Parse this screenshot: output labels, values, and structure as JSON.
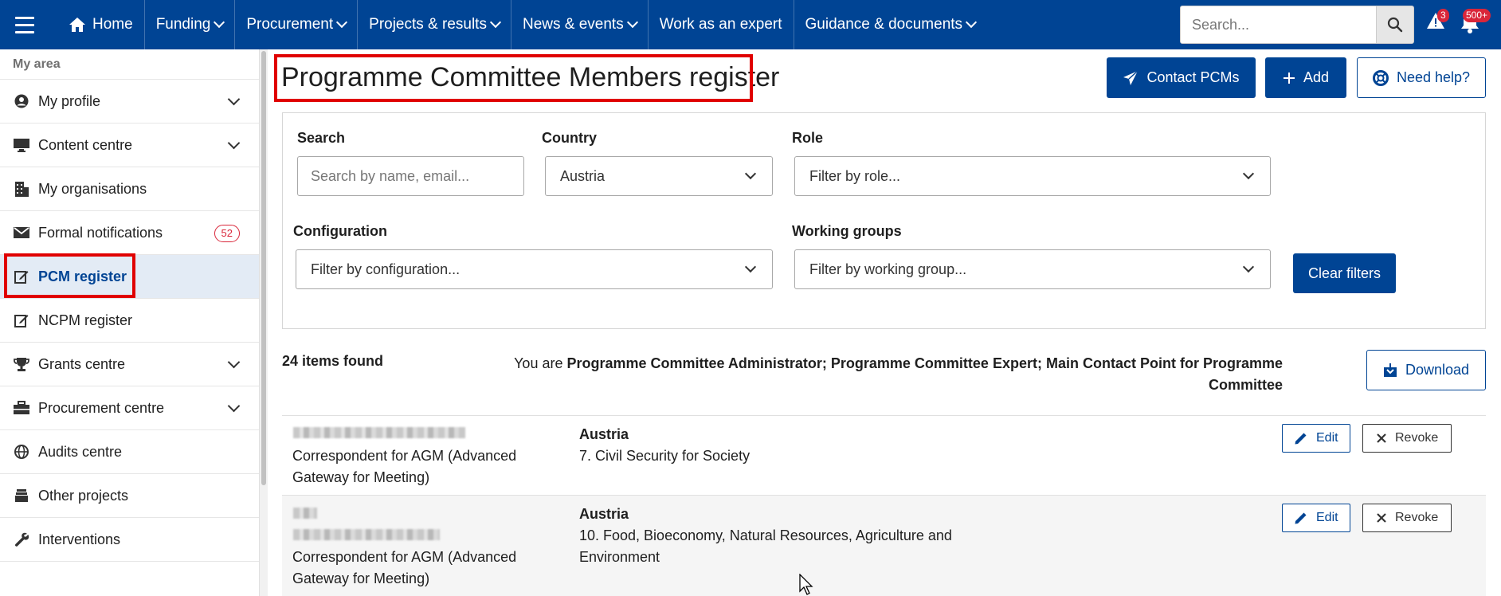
{
  "nav": {
    "home": "Home",
    "items": [
      "Funding",
      "Procurement",
      "Projects & results",
      "News & events",
      "Work as an expert",
      "Guidance & documents"
    ],
    "search_placeholder": "Search...",
    "alerts_count": "3",
    "notifications_count": "500+"
  },
  "sidebar": {
    "title": "My area",
    "items": [
      {
        "label": "My profile"
      },
      {
        "label": "Content centre"
      },
      {
        "label": "My organisations"
      },
      {
        "label": "Formal notifications",
        "badge": "52"
      },
      {
        "label": "PCM register"
      },
      {
        "label": "NCPM register"
      },
      {
        "label": "Grants centre"
      },
      {
        "label": "Procurement centre"
      },
      {
        "label": "Audits centre"
      },
      {
        "label": "Other projects"
      },
      {
        "label": "Interventions"
      }
    ]
  },
  "page": {
    "title": "Programme Committee Members register",
    "contact_label": "Contact PCMs",
    "add_label": "Add",
    "help_label": "Need help?"
  },
  "filters": {
    "search_label": "Search",
    "search_placeholder": "Search by name, email...",
    "country_label": "Country",
    "country_value": "Austria",
    "role_label": "Role",
    "role_placeholder": "Filter by role...",
    "configuration_label": "Configuration",
    "configuration_placeholder": "Filter by configuration...",
    "working_groups_label": "Working groups",
    "working_groups_placeholder": "Filter by working group...",
    "clear_label": "Clear filters"
  },
  "results": {
    "count": "24 items found",
    "you_are": "You are",
    "roles": "Programme Committee Administrator; Programme Committee Expert; Main Contact Point for Programme Committee",
    "download_label": "Download"
  },
  "rows": [
    {
      "role_line1": "Correspondent for AGM (Advanced",
      "role_line2": "Gateway for Meeting)",
      "country": "Austria",
      "config_line1": "7. Civil Security for Society",
      "config_line2": "",
      "edit": "Edit",
      "revoke": "Revoke"
    },
    {
      "role_line1": "Correspondent for AGM (Advanced",
      "role_line2": "Gateway for Meeting)",
      "country": "Austria",
      "config_line1": "10. Food, Bioeconomy, Natural Resources, Agriculture and",
      "config_line2": "Environment",
      "edit": "Edit",
      "revoke": "Revoke"
    }
  ],
  "colors": {
    "brand": "#004494",
    "highlight": "#e00000",
    "badge": "#d9263a"
  }
}
